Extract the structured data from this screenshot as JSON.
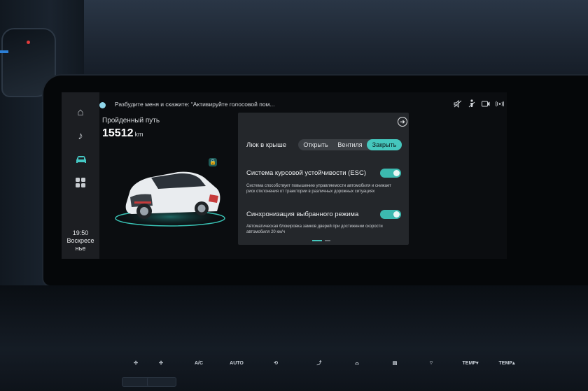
{
  "voice": {
    "prompt": "Разбудите меня и скажите: “Активируйте голосовой пом..."
  },
  "sidebar": {
    "items": [
      {
        "icon": "home-icon",
        "glyph": "⌂"
      },
      {
        "icon": "music-icon",
        "glyph": "♪"
      },
      {
        "icon": "car-icon",
        "glyph": "🚗"
      },
      {
        "icon": "apps-icon",
        "glyph": "▦"
      }
    ],
    "time": "19:50",
    "day_line1": "Воскресе",
    "day_line2": "нье"
  },
  "status_icons": [
    "mute-icon",
    "seat-belt-icon",
    "dashcam-icon",
    "signal-icon"
  ],
  "trip": {
    "label": "Пройденный путь",
    "value": "15512",
    "unit": "km"
  },
  "panel": {
    "sunroof": {
      "label": "Люк в крыше",
      "options": [
        "Открыть",
        "Вентиля",
        "Закрыть"
      ],
      "selected": "Закрыть"
    },
    "esc": {
      "label": "Система курсовой устойчивости (ESC)",
      "enabled": true,
      "description": "Система способствует повышению управляемости автомобиля и снижает риск отклонения от траектории в различных дорожных ситуациях"
    },
    "sync": {
      "label": "Синхронизация выбранного режима",
      "enabled": true,
      "description": "Автоматическая блокировка замков дверей при достижении скорости автомобиля 20 км/ч"
    }
  },
  "console": {
    "controls": [
      "A/C",
      "AUTO",
      "TEMP▾",
      "TEMP▴"
    ]
  },
  "colors": {
    "accent": "#45c7bd",
    "panel_bg": "#24272b",
    "sidebar_bg": "#1c1e22"
  }
}
